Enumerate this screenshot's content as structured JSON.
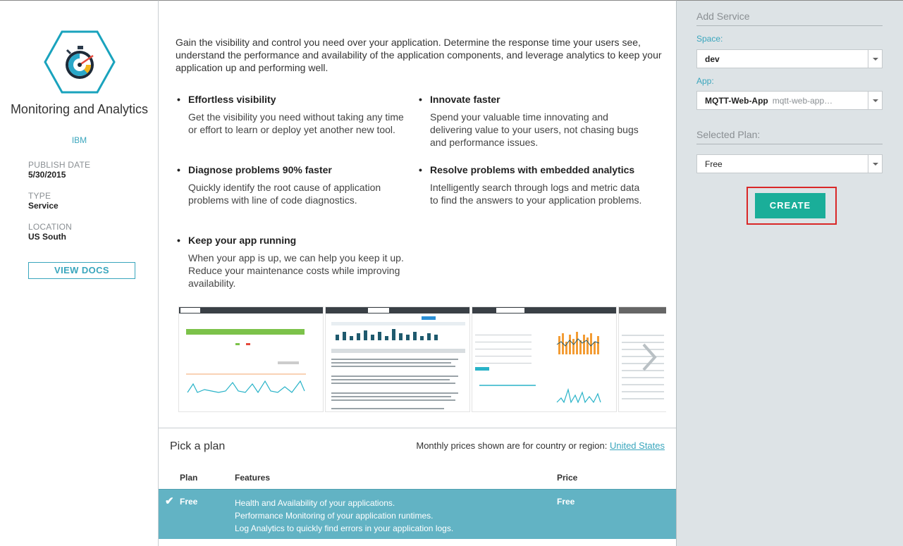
{
  "service": {
    "title": "Monitoring and Analytics",
    "vendor": "IBM",
    "publish_date_label": "PUBLISH DATE",
    "publish_date": "5/30/2015",
    "type_label": "TYPE",
    "type": "Service",
    "location_label": "LOCATION",
    "location": "US South",
    "view_docs": "VIEW DOCS",
    "logo_icon": "stopwatch-hexagon-icon",
    "accent_color": "#3aa6bd"
  },
  "intro": "Gain the visibility and control you need over your application. Determine the response time your users see, understand the performance and availability of the application components, and leverage analytics to keep your application up and performing well.",
  "features": [
    {
      "title": "Effortless visibility",
      "desc": "Get the visibility you need without taking any time or effort to learn or deploy yet another new tool."
    },
    {
      "title": "Innovate faster",
      "desc": "Spend your valuable time innovating and delivering value to your users, not chasing bugs and performance issues."
    },
    {
      "title": "Diagnose problems 90% faster",
      "desc": "Quickly identify the root cause of application problems with line of code diagnostics."
    },
    {
      "title": "Resolve problems with embedded analytics",
      "desc": "Intelligently search through logs and metric data to find the answers to your application problems."
    },
    {
      "title": "Keep your app running",
      "desc": "When your app is up, we can help you keep it up. Reduce your maintenance costs while improving availability."
    }
  ],
  "plans": {
    "heading": "Pick a plan",
    "price_note": "Monthly prices shown are for country or region:",
    "region_link": "United States",
    "col_plan": "Plan",
    "col_features": "Features",
    "col_price": "Price",
    "rows": [
      {
        "selected_mark": "✔",
        "name": "Free",
        "features": [
          "Health and Availability of your applications.",
          "Performance Monitoring of your application runtimes.",
          "Log Analytics to quickly find errors in your application logs."
        ],
        "price": "Free"
      }
    ],
    "row_color": "#62b3c4"
  },
  "add_service": {
    "heading": "Add Service",
    "space_label": "Space:",
    "space_value": "dev",
    "app_label": "App:",
    "app_value": "MQTT-Web-App",
    "app_sub": "mqtt-web-app…",
    "plan_heading": "Selected Plan:",
    "plan_value": "Free",
    "create_label": "CREATE",
    "create_color": "#1aae99"
  }
}
